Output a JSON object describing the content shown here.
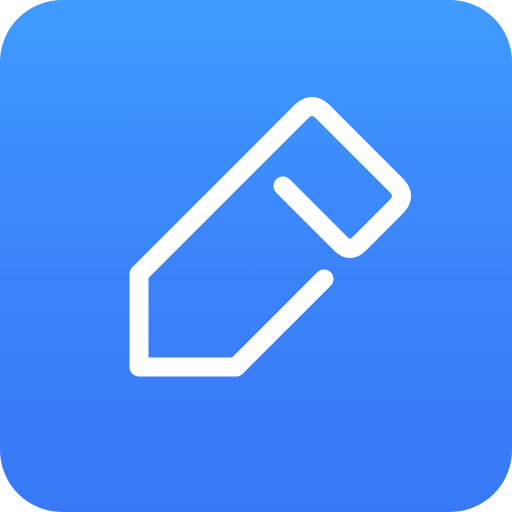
{
  "app_icon": {
    "icon": "pencil-icon",
    "colors": {
      "background_top": "#3f9bff",
      "background_bottom": "#3979f6",
      "stroke": "#ffffff"
    }
  }
}
